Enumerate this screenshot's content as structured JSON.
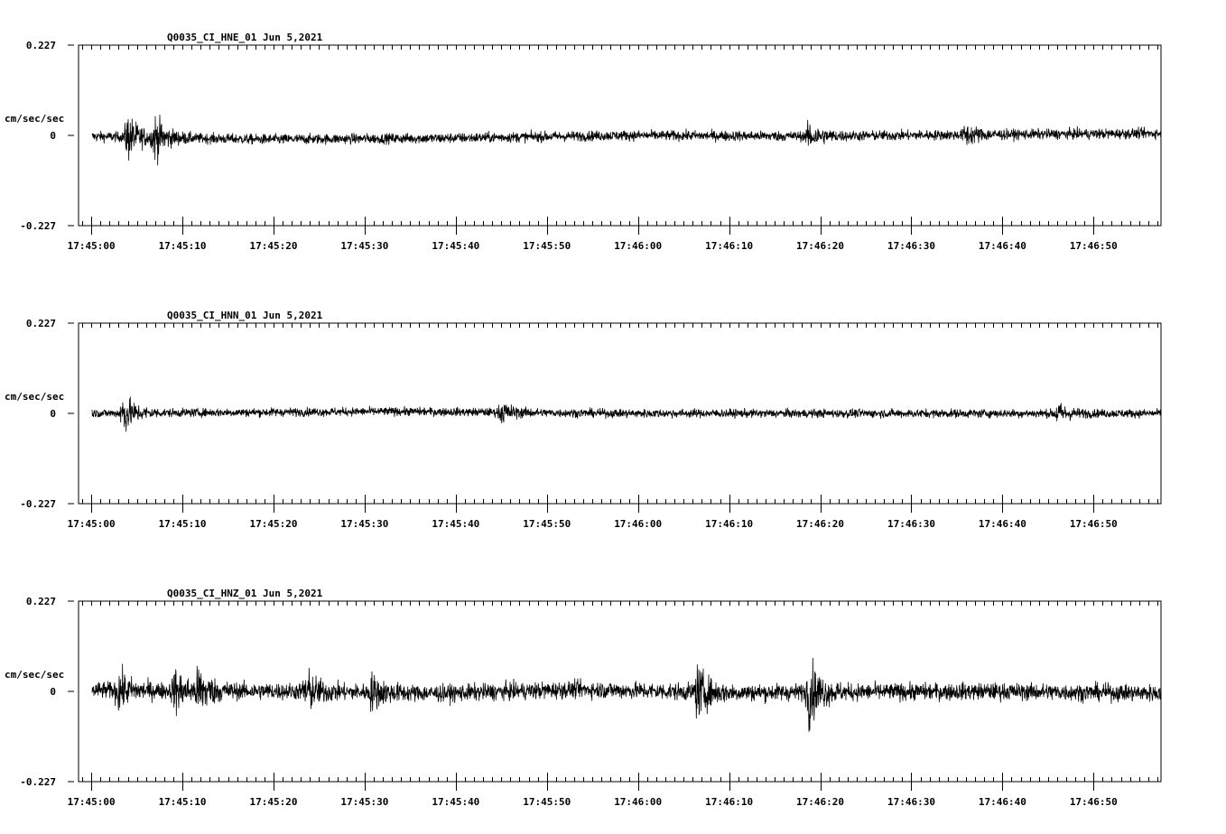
{
  "chart_data": [
    {
      "type": "line",
      "title": "Q0035_CI_HNE_01  Jun 5,2021",
      "ylabel": "cm/sec/sec",
      "ylim": [
        -0.227,
        0.227
      ],
      "y_ticks": [
        "0.227",
        "0",
        "-0.227"
      ],
      "x_range": [
        "17:44:58.6",
        "17:46:57.4"
      ],
      "x_ticks": [
        "17:45:00",
        "17:45:10",
        "17:45:20",
        "17:45:30",
        "17:45:40",
        "17:45:50",
        "17:46:00",
        "17:46:10",
        "17:46:20",
        "17:46:30",
        "17:46:40",
        "17:46:50"
      ],
      "series": [
        {
          "noise_amplitude": 0.012,
          "events": [
            {
              "t": "17:45:04",
              "amp": 0.05
            },
            {
              "t": "17:45:07",
              "amp": 0.045
            },
            {
              "t": "17:46:18.8",
              "amp": 0.025
            },
            {
              "t": "17:46:36",
              "amp": 0.02
            }
          ],
          "baseline": [
            [
              0,
              -0.002
            ],
            [
              20,
              -0.01
            ],
            [
              40,
              -0.007
            ],
            [
              60,
              0.0
            ],
            [
              80,
              -0.002
            ],
            [
              100,
              0.002
            ],
            [
              118,
              0.005
            ]
          ]
        }
      ]
    },
    {
      "type": "line",
      "title": "Q0035_CI_HNN_01  Jun 5,2021",
      "ylabel": "cm/sec/sec",
      "ylim": [
        -0.227,
        0.227
      ],
      "y_ticks": [
        "0.227",
        "0",
        "-0.227"
      ],
      "x_range": [
        "17:44:58.6",
        "17:46:57.4"
      ],
      "x_ticks": [
        "17:45:00",
        "17:45:10",
        "17:45:20",
        "17:45:30",
        "17:45:40",
        "17:45:50",
        "17:46:00",
        "17:46:10",
        "17:46:20",
        "17:46:30",
        "17:46:40",
        "17:46:50"
      ],
      "series": [
        {
          "noise_amplitude": 0.01,
          "events": [
            {
              "t": "17:45:03.5",
              "amp": 0.045
            },
            {
              "t": "17:45:45",
              "amp": 0.02
            },
            {
              "t": "17:46:46",
              "amp": 0.02
            }
          ],
          "baseline": [
            [
              0,
              0.0
            ],
            [
              35,
              0.005
            ],
            [
              60,
              0.0
            ],
            [
              90,
              0.0
            ],
            [
              118,
              0.0
            ]
          ]
        }
      ]
    },
    {
      "type": "line",
      "title": "Q0035_CI_HNZ_01  Jun 5,2021",
      "ylabel": "cm/sec/sec",
      "ylim": [
        -0.227,
        0.227
      ],
      "y_ticks": [
        "0.227",
        "0",
        "-0.227"
      ],
      "x_range": [
        "17:44:58.6",
        "17:46:57.4"
      ],
      "x_ticks": [
        "17:45:00",
        "17:45:10",
        "17:45:20",
        "17:45:30",
        "17:45:40",
        "17:45:50",
        "17:46:00",
        "17:46:10",
        "17:46:20",
        "17:46:30",
        "17:46:40",
        "17:46:50"
      ],
      "series": [
        {
          "noise_amplitude": 0.02,
          "events": [
            {
              "t": "17:45:03",
              "amp": 0.035
            },
            {
              "t": "17:45:09.2",
              "amp": 0.04
            },
            {
              "t": "17:45:11.8",
              "amp": 0.045
            },
            {
              "t": "17:45:23.6",
              "amp": 0.04
            },
            {
              "t": "17:45:30.8",
              "amp": 0.03
            },
            {
              "t": "17:46:06.5",
              "amp": 0.05
            },
            {
              "t": "17:46:18.8",
              "amp": 0.065
            }
          ],
          "baseline": [
            [
              0,
              0.003
            ],
            [
              25,
              0.0
            ],
            [
              40,
              -0.005
            ],
            [
              55,
              0.005
            ],
            [
              70,
              -0.003
            ],
            [
              100,
              0.0
            ],
            [
              118,
              -0.004
            ]
          ]
        }
      ]
    }
  ]
}
